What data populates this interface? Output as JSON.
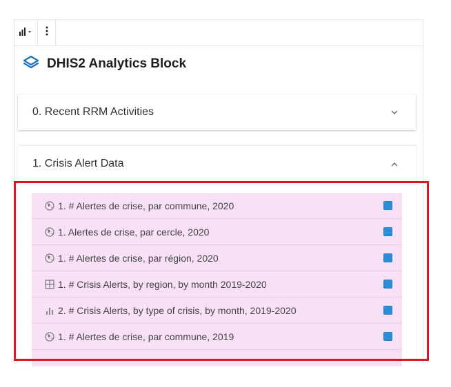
{
  "toolbar": {
    "chart_button_icon": "bar-chart-dropdown-icon",
    "more_button_icon": "vertical-ellipsis-icon"
  },
  "block": {
    "title": "DHIS2 Analytics Block",
    "logo_icon": "layers-diamond-icon",
    "accent_color": "#1b73ba"
  },
  "panels": [
    {
      "title": "0. Recent RRM Activities",
      "expanded": false,
      "chevron_icon": "chevron-down-icon"
    },
    {
      "title": "1. Crisis Alert Data",
      "expanded": true,
      "chevron_icon": "chevron-up-icon"
    }
  ],
  "items": [
    {
      "label": "1. # Alertes de crise, par commune, 2020",
      "icon": "globe-map-icon",
      "checked": true
    },
    {
      "label": "1. Alertes de crise, par cercle, 2020",
      "icon": "globe-map-icon",
      "checked": true
    },
    {
      "label": "1. # Alertes de crise, par région, 2020",
      "icon": "globe-map-icon",
      "checked": true
    },
    {
      "label": "1. # Crisis Alerts, by region, by month 2019-2020",
      "icon": "pivot-table-icon",
      "checked": true
    },
    {
      "label": "2. # Crisis Alerts, by type of crisis, by month, 2019-2020",
      "icon": "bar-chart-icon",
      "checked": true
    },
    {
      "label": "1. # Alertes de crise, par commune, 2019",
      "icon": "globe-map-icon",
      "checked": true
    }
  ],
  "colors": {
    "list_background": "#f8e0f6",
    "checkbox": "#2a8fd6",
    "highlight_border": "#e0141e"
  }
}
